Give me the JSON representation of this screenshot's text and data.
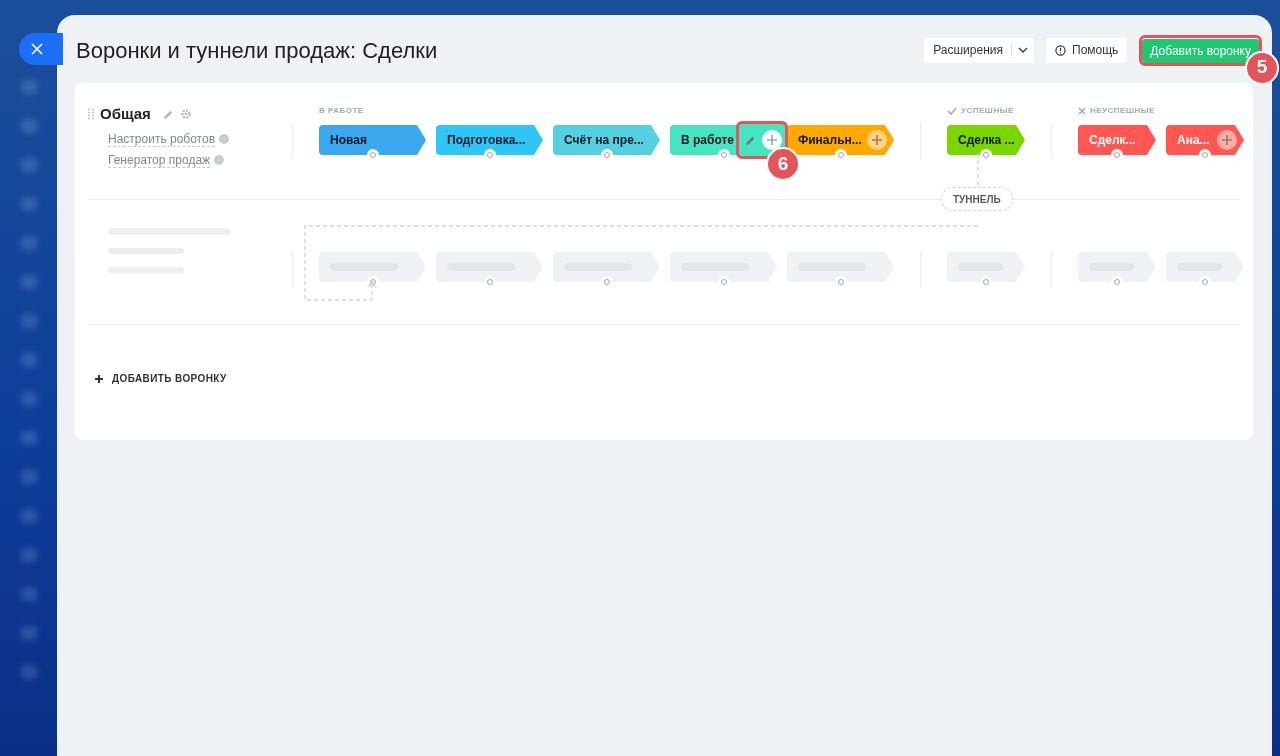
{
  "window": {
    "title": "Воронки и туннели продаж: Сделки"
  },
  "toolbar": {
    "extensions_button": "Расширения",
    "help_button": "Помощь",
    "add_funnel_button": "Добавить воронку",
    "add_funnel_marker": "5"
  },
  "funnel": {
    "name": "Общая",
    "links": [
      "Настроить роботов",
      "Генератор продаж"
    ],
    "groups": [
      {
        "kind": "progress",
        "label": "В РАБОТЕ",
        "stages": [
          {
            "name": "Новая",
            "color": "#3ba7ef",
            "hovered": false,
            "add_button": false
          },
          {
            "name": "Подготовка...",
            "color": "#2fc6f6",
            "hovered": false,
            "add_button": false
          },
          {
            "name": "Счёт на пре...",
            "color": "#55d0e0",
            "hovered": false,
            "add_button": false
          },
          {
            "name": "В работе",
            "color": "#47e4c2",
            "hovered": true,
            "add_button": false,
            "marker": "6"
          },
          {
            "name": "Финальн...",
            "color": "#ffa900",
            "hovered": false,
            "add_button": true
          }
        ]
      },
      {
        "kind": "success",
        "label": "УСПЕШНЫЕ",
        "stages": [
          {
            "name": "Сделка ...",
            "color": "#7bd500",
            "hovered": false,
            "add_button": false
          }
        ]
      },
      {
        "kind": "failure",
        "label": "НЕУСПЕШНЫЕ",
        "stages": [
          {
            "name": "Сделк...",
            "color": "#ff5752",
            "hovered": false,
            "add_button": false
          },
          {
            "name": "Ана...",
            "color": "#ff5752",
            "hovered": false,
            "add_button": true
          }
        ]
      }
    ]
  },
  "tunnel": {
    "label": "ТУННЕЛЬ"
  },
  "add_funnel_link": "ДОБАВИТЬ ВОРОНКУ"
}
